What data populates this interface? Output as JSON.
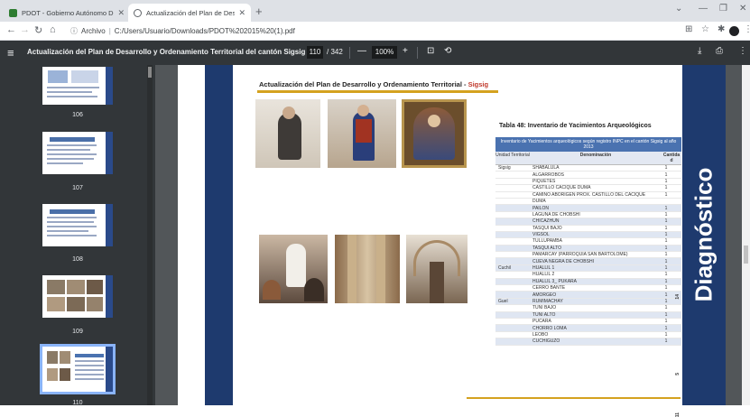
{
  "tabs": [
    {
      "title": "PDOT - Gobierno Autónomo Des",
      "color": "#2e7d32"
    },
    {
      "title": "Actualización del Plan de Desarr",
      "color": "#5f6368"
    }
  ],
  "address": {
    "scheme": "Archivo",
    "path": "C:/Users/Usuario/Downloads/PDOT%202015%20(1).pdf"
  },
  "pdf": {
    "title": "Actualización del Plan de Desarrollo y Ordenamiento Territorial del cantón Sigsig",
    "page": "110",
    "of": "/ 342",
    "zoom": "100%"
  },
  "thumbs": [
    "106",
    "107",
    "108",
    "109",
    "110"
  ],
  "page": {
    "header": "Actualización del Plan de Desarrollo y Ordenamiento Territorial - ",
    "header_accent": "Sigsig",
    "side_label": "Diagnóstico",
    "table_caption": "Tabla 48: Inventario de Yacimientos Arqueológicos",
    "table_title": "Inventario de Yacimientos arqueológicos según registro INPC en el cantón Sigsig al año 2013",
    "col_unit": "Unidad Territorial",
    "col_name": "Denominación",
    "col_qty": "Cantida d",
    "rows": [
      {
        "unit": "Sigsig",
        "name": "SHABALULA",
        "q": "1"
      },
      {
        "unit": "",
        "name": "ALGARROBOS",
        "q": "1"
      },
      {
        "unit": "",
        "name": "PIQUETES",
        "q": "1"
      },
      {
        "unit": "",
        "name": "CASTILLO CACIQUE DUMA",
        "q": "1"
      },
      {
        "unit": "",
        "name": "CAMINO ABORIGEN PROX. CASTILLO DEL CACIQUE",
        "q": "1"
      },
      {
        "unit": "",
        "name": "DUMA",
        "q": ""
      },
      {
        "unit": "",
        "name": "PAILÓN",
        "q": "1"
      },
      {
        "unit": "",
        "name": "LAGUNA DE CHOBSHI",
        "q": "1"
      },
      {
        "unit": "",
        "name": "CHICAZHUN",
        "q": "1"
      },
      {
        "unit": "",
        "name": "TASQUI BAJO",
        "q": "1"
      },
      {
        "unit": "",
        "name": "VIGSOL",
        "q": "1"
      },
      {
        "unit": "",
        "name": "TULLUPAMBA",
        "q": "1"
      },
      {
        "unit": "",
        "name": "TASQUI ALTO",
        "q": "1"
      },
      {
        "unit": "",
        "name": "PAMARCAY (PARROQUIA SAN BARTOLOMÉ)",
        "q": "1"
      },
      {
        "unit": "",
        "name": "CUEVA NEGRA DE CHOBSHI",
        "q": "1"
      },
      {
        "unit": "Cuchil",
        "name": "HUALLIL 1",
        "q": "1"
      },
      {
        "unit": "",
        "name": "HUALLIL 2",
        "q": "1"
      },
      {
        "unit": "",
        "name": "HUALLIL 3_ PUKARA",
        "q": "1"
      },
      {
        "unit": "",
        "name": "CERRO BANTE",
        "q": "1"
      },
      {
        "unit": "",
        "name": "AMORGEO",
        "q": "1"
      },
      {
        "unit": "Guel",
        "name": "RUMIMACHAY",
        "q": "1"
      },
      {
        "unit": "",
        "name": "TUÑI BAJO",
        "q": "1"
      },
      {
        "unit": "",
        "name": "TUÑI ALTO",
        "q": "1"
      },
      {
        "unit": "",
        "name": "PUCARÁ",
        "q": "1"
      },
      {
        "unit": "",
        "name": "CHORRO LOMA",
        "q": "1"
      },
      {
        "unit": "",
        "name": "LEOBO",
        "q": "1"
      },
      {
        "unit": "",
        "name": "CUCHIGUZO",
        "q": "1"
      }
    ],
    "group_totals": [
      "14",
      "5",
      "11"
    ]
  }
}
